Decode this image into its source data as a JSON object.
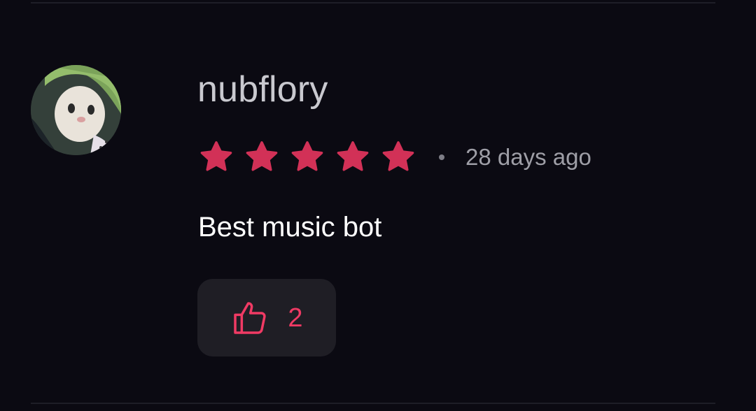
{
  "review": {
    "username": "nubflory",
    "rating": 5,
    "rating_max": 5,
    "timestamp": "28 days ago",
    "text": "Best music bot",
    "likes": "2"
  },
  "colors": {
    "background": "#0b0a12",
    "star": "#d23157",
    "accent": "#f03a64",
    "like_button_bg": "#1f1e25"
  },
  "icons": {
    "avatar": "avatar-image",
    "star": "star-icon",
    "like": "thumbs-up-icon"
  }
}
